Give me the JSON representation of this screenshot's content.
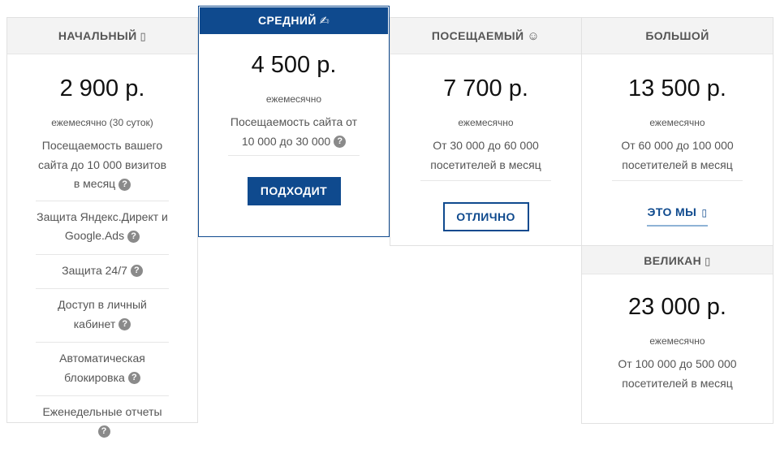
{
  "plans": [
    {
      "name": "НАЧАЛЬНЫЙ",
      "name_icon": "▯",
      "price": "2 900 р.",
      "period": "ежемесячно (30 суток)",
      "features": [
        "Посещаемость вашего сайта до 10 000 визитов в месяц",
        "Защита Яндекс.Директ и Google.Ads",
        "Защита 24/7",
        "Доступ в личный кабинет",
        "Автоматическая блокировка",
        "Еженедельные отчеты"
      ]
    },
    {
      "name": "СРЕДНИЙ",
      "name_icon": "✍",
      "price": "4 500 р.",
      "period": "ежемесячно",
      "feature": "Посещаемость сайта от 10 000 до 30 000",
      "button": "ПОДХОДИТ"
    },
    {
      "name": "ПОСЕЩАЕМЫЙ",
      "name_icon": "☺",
      "price": "7 700 р.",
      "period": "ежемесячно",
      "feature": "От 30 000 до 60 000 посетителей в месяц",
      "button": "ОТЛИЧНО"
    },
    {
      "name": "БОЛЬШОЙ",
      "price": "13 500 р.",
      "period": "ежемесячно",
      "feature": "От 60 000 до 100 000 посетителей в месяц",
      "button": "ЭТО МЫ",
      "button_icon": "▯"
    },
    {
      "name": "ВЕЛИКАН",
      "name_icon": "▯",
      "price": "23 000 р.",
      "period": "ежемесячно",
      "feature": "От 100 000 до 500 000 посетителей в месяц"
    }
  ],
  "help_glyph": "?",
  "colors": {
    "primary": "#0f4a8e",
    "header_bg": "#f3f3f3",
    "border": "#e1e1e1"
  }
}
